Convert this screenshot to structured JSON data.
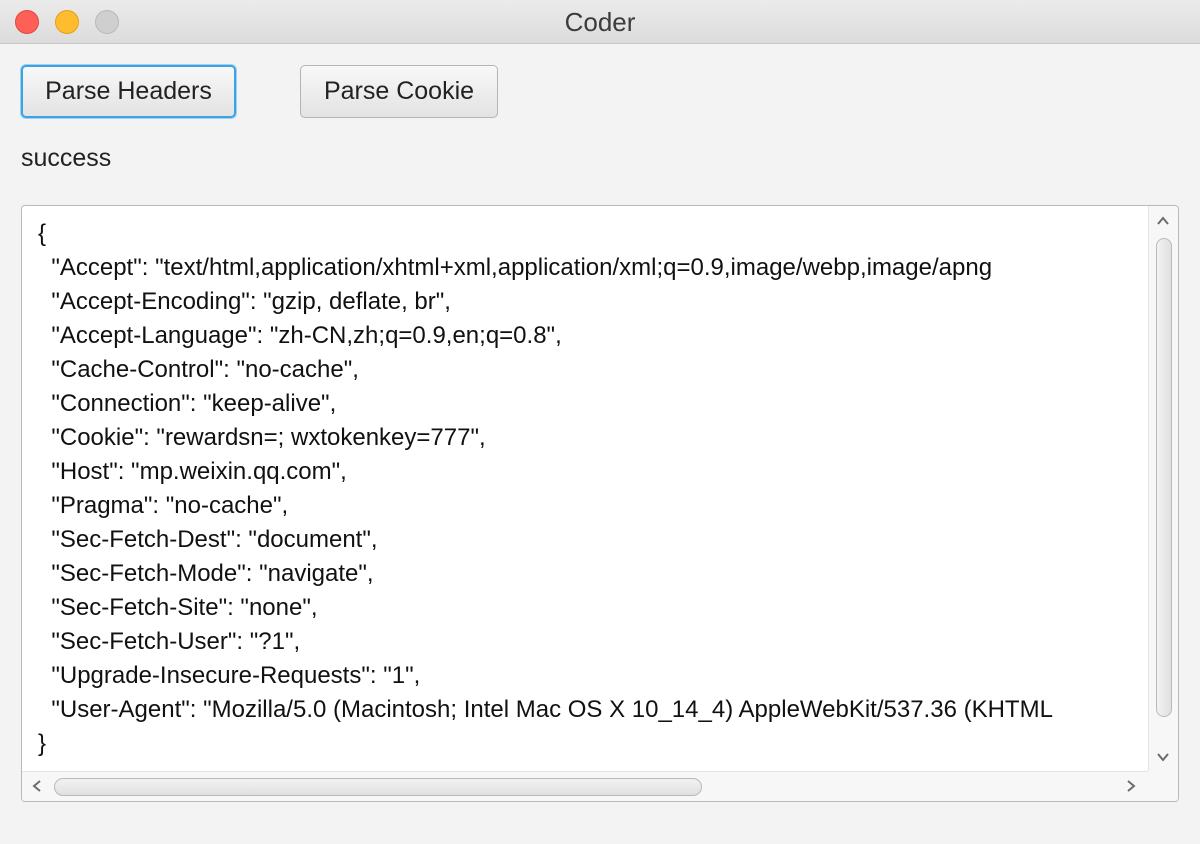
{
  "window": {
    "title": "Coder"
  },
  "toolbar": {
    "parse_headers_label": "Parse Headers",
    "parse_cookie_label": "Parse Cookie"
  },
  "status": {
    "text": "success"
  },
  "output": {
    "lines": [
      "{",
      "  \"Accept\": \"text/html,application/xhtml+xml,application/xml;q=0.9,image/webp,image/apng",
      "  \"Accept-Encoding\": \"gzip, deflate, br\",",
      "  \"Accept-Language\": \"zh-CN,zh;q=0.9,en;q=0.8\",",
      "  \"Cache-Control\": \"no-cache\",",
      "  \"Connection\": \"keep-alive\",",
      "  \"Cookie\": \"rewardsn=; wxtokenkey=777\",",
      "  \"Host\": \"mp.weixin.qq.com\",",
      "  \"Pragma\": \"no-cache\",",
      "  \"Sec-Fetch-Dest\": \"document\",",
      "  \"Sec-Fetch-Mode\": \"navigate\",",
      "  \"Sec-Fetch-Site\": \"none\",",
      "  \"Sec-Fetch-User\": \"?1\",",
      "  \"Upgrade-Insecure-Requests\": \"1\",",
      "  \"User-Agent\": \"Mozilla/5.0 (Macintosh; Intel Mac OS X 10_14_4) AppleWebKit/537.36 (KHTML",
      "}"
    ]
  },
  "colors": {
    "focus_ring": "#3aa3e3",
    "close": "#fe5f57",
    "minimize": "#febc2e",
    "maximize": "#cfcfcf"
  }
}
